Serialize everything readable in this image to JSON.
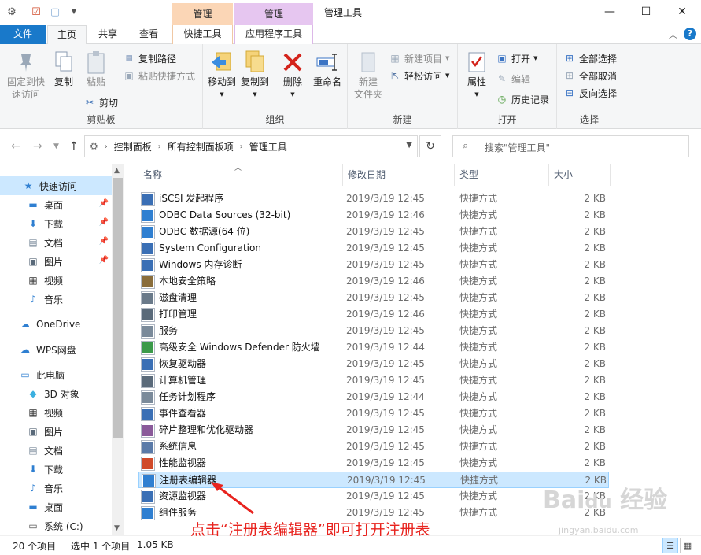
{
  "window": {
    "title": "管理工具",
    "ctx_tab1_header": "管理",
    "ctx_tab2_header": "管理"
  },
  "tabs": {
    "file": "文件",
    "home": "主页",
    "share": "共享",
    "view": "查看",
    "shortcut_tools": "快捷工具",
    "app_tools": "应用程序工具"
  },
  "ribbon": {
    "clipboard": {
      "label": "剪贴板",
      "pin": "固定到快\n速访问",
      "copy": "复制",
      "paste": "粘贴",
      "copy_path": "复制路径",
      "paste_shortcut": "粘贴快捷方式",
      "cut": "剪切"
    },
    "organize": {
      "label": "组织",
      "move_to": "移动到",
      "copy_to": "复制到",
      "delete": "删除",
      "rename": "重命名"
    },
    "new": {
      "label": "新建",
      "new_folder": "新建\n文件夹",
      "new_item": "新建项目",
      "easy_access": "轻松访问"
    },
    "open": {
      "label": "打开",
      "properties": "属性",
      "open": "打开",
      "edit": "编辑",
      "history": "历史记录"
    },
    "select": {
      "label": "选择",
      "select_all": "全部选择",
      "select_none": "全部取消",
      "invert": "反向选择"
    }
  },
  "address": {
    "crumbs": [
      "控制面板",
      "所有控制面板项",
      "管理工具"
    ],
    "search_placeholder": "搜索\"管理工具\""
  },
  "nav": {
    "items": [
      {
        "label": "快速访问",
        "icon": "star-icon"
      },
      {
        "label": "桌面",
        "icon": "desktop-icon"
      },
      {
        "label": "下载",
        "icon": "download-icon"
      },
      {
        "label": "文档",
        "icon": "document-icon"
      },
      {
        "label": "图片",
        "icon": "picture-icon"
      },
      {
        "label": "视频",
        "icon": "video-icon"
      },
      {
        "label": "音乐",
        "icon": "music-icon"
      },
      {
        "label": "OneDrive",
        "icon": "cloud-icon"
      },
      {
        "label": "WPS网盘",
        "icon": "wps-cloud-icon"
      },
      {
        "label": "此电脑",
        "icon": "computer-icon"
      },
      {
        "label": "3D 对象",
        "icon": "cube-icon"
      },
      {
        "label": "视频",
        "icon": "video-icon"
      },
      {
        "label": "图片",
        "icon": "picture-icon"
      },
      {
        "label": "文档",
        "icon": "document-icon"
      },
      {
        "label": "下载",
        "icon": "download-icon"
      },
      {
        "label": "音乐",
        "icon": "music-icon"
      },
      {
        "label": "桌面",
        "icon": "desktop-icon"
      },
      {
        "label": "系统 (C:)",
        "icon": "drive-icon"
      }
    ]
  },
  "columns": {
    "name": "名称",
    "date": "修改日期",
    "type": "类型",
    "size": "大小"
  },
  "files": [
    {
      "name": "iSCSI 发起程序",
      "date": "2019/3/19 12:45",
      "type": "快捷方式",
      "size": "2 KB"
    },
    {
      "name": "ODBC Data Sources (32-bit)",
      "date": "2019/3/19 12:46",
      "type": "快捷方式",
      "size": "2 KB"
    },
    {
      "name": "ODBC 数据源(64 位)",
      "date": "2019/3/19 12:45",
      "type": "快捷方式",
      "size": "2 KB"
    },
    {
      "name": "System Configuration",
      "date": "2019/3/19 12:45",
      "type": "快捷方式",
      "size": "2 KB"
    },
    {
      "name": "Windows 内存诊断",
      "date": "2019/3/19 12:45",
      "type": "快捷方式",
      "size": "2 KB"
    },
    {
      "name": "本地安全策略",
      "date": "2019/3/19 12:46",
      "type": "快捷方式",
      "size": "2 KB"
    },
    {
      "name": "磁盘清理",
      "date": "2019/3/19 12:45",
      "type": "快捷方式",
      "size": "2 KB"
    },
    {
      "name": "打印管理",
      "date": "2019/3/19 12:46",
      "type": "快捷方式",
      "size": "2 KB"
    },
    {
      "name": "服务",
      "date": "2019/3/19 12:45",
      "type": "快捷方式",
      "size": "2 KB"
    },
    {
      "name": "高级安全 Windows Defender 防火墙",
      "date": "2019/3/19 12:44",
      "type": "快捷方式",
      "size": "2 KB"
    },
    {
      "name": "恢复驱动器",
      "date": "2019/3/19 12:45",
      "type": "快捷方式",
      "size": "2 KB"
    },
    {
      "name": "计算机管理",
      "date": "2019/3/19 12:45",
      "type": "快捷方式",
      "size": "2 KB"
    },
    {
      "name": "任务计划程序",
      "date": "2019/3/19 12:44",
      "type": "快捷方式",
      "size": "2 KB"
    },
    {
      "name": "事件查看器",
      "date": "2019/3/19 12:45",
      "type": "快捷方式",
      "size": "2 KB"
    },
    {
      "name": "碎片整理和优化驱动器",
      "date": "2019/3/19 12:45",
      "type": "快捷方式",
      "size": "2 KB"
    },
    {
      "name": "系统信息",
      "date": "2019/3/19 12:45",
      "type": "快捷方式",
      "size": "2 KB"
    },
    {
      "name": "性能监视器",
      "date": "2019/3/19 12:45",
      "type": "快捷方式",
      "size": "2 KB"
    },
    {
      "name": "注册表编辑器",
      "date": "2019/3/19 12:45",
      "type": "快捷方式",
      "size": "2 KB",
      "selected": true
    },
    {
      "name": "资源监视器",
      "date": "2019/3/19 12:45",
      "type": "快捷方式",
      "size": "2 KB"
    },
    {
      "name": "组件服务",
      "date": "2019/3/19 12:45",
      "type": "快捷方式",
      "size": "2 KB"
    }
  ],
  "status": {
    "count": "20 个项目",
    "selected": "选中 1 个项目",
    "size": "1.05 KB"
  },
  "annotation": "点击“注册表编辑器”即可打开注册表",
  "watermark": {
    "logo": "Baidu 经验",
    "url": "jingyan.baidu.com"
  },
  "colors": {
    "file_tab": "#1979ca",
    "selection": "#cce8ff",
    "annotation": "#e8231e"
  }
}
